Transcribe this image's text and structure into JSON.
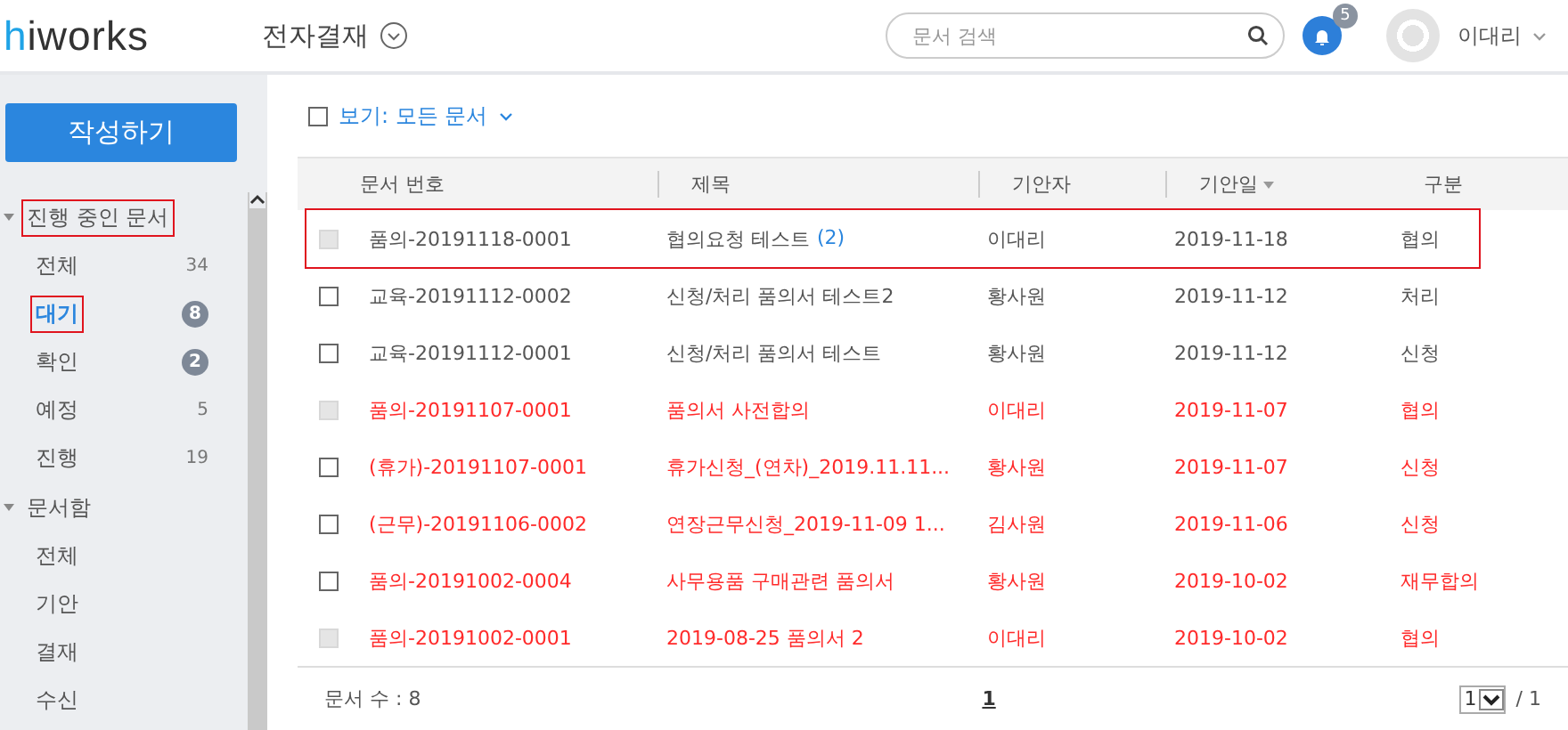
{
  "header": {
    "logo": {
      "accent": "h",
      "rest": "iworks"
    },
    "app_title": "전자결재",
    "search": {
      "placeholder": "문서 검색"
    },
    "notifications": {
      "count": "5"
    },
    "user": {
      "name": "이대리"
    }
  },
  "sidebar": {
    "compose_button": "작성하기",
    "sections": [
      {
        "label": "진행 중인 문서",
        "expanded": true,
        "highlighted": true,
        "children": [
          {
            "label": "전체",
            "count": "34",
            "kind": "plain",
            "selected": false,
            "highlighted": false
          },
          {
            "label": "대기",
            "count": "8",
            "kind": "badge",
            "selected": true,
            "highlighted": true
          },
          {
            "label": "확인",
            "count": "2",
            "kind": "badge",
            "selected": false,
            "highlighted": false
          },
          {
            "label": "예정",
            "count": "5",
            "kind": "plain",
            "selected": false,
            "highlighted": false
          },
          {
            "label": "진행",
            "count": "19",
            "kind": "plain",
            "selected": false,
            "highlighted": false
          }
        ]
      },
      {
        "label": "문서함",
        "expanded": true,
        "highlighted": false,
        "children": [
          {
            "label": "전체",
            "selected": false,
            "highlighted": false
          },
          {
            "label": "기안",
            "selected": false,
            "highlighted": false
          },
          {
            "label": "결재",
            "selected": false,
            "highlighted": false
          },
          {
            "label": "수신",
            "selected": false,
            "highlighted": false
          }
        ]
      }
    ]
  },
  "filter": {
    "label": "보기: 모든 문서",
    "checked": false
  },
  "table": {
    "columns": [
      {
        "label": "문서 번호",
        "sorted": false
      },
      {
        "label": "제목",
        "sorted": false
      },
      {
        "label": "기안자",
        "sorted": false
      },
      {
        "label": "기안일",
        "sorted": true
      },
      {
        "label": "구분",
        "sorted": false
      }
    ],
    "rows": [
      {
        "number": "품의-20191118-0001",
        "title": "협의요청 테스트",
        "comments": "(2)",
        "drafter": "이대리",
        "date": "2019-11-18",
        "type": "협의",
        "color": "#555555",
        "disabled": true,
        "highlighted": true
      },
      {
        "number": "교육-20191112-0002",
        "title": "신청/처리 품의서 테스트2",
        "drafter": "황사원",
        "date": "2019-11-12",
        "type": "처리",
        "color": "#555555",
        "disabled": false,
        "highlighted": false
      },
      {
        "number": "교육-20191112-0001",
        "title": "신청/처리 품의서 테스트",
        "drafter": "황사원",
        "date": "2019-11-12",
        "type": "신청",
        "color": "#555555",
        "disabled": false,
        "highlighted": false
      },
      {
        "number": "품의-20191107-0001",
        "title": "품의서 사전합의",
        "drafter": "이대리",
        "date": "2019-11-07",
        "type": "협의",
        "color": "#ff2a2a",
        "disabled": true,
        "highlighted": false
      },
      {
        "number": "(휴가)-20191107-0001",
        "title": "휴가신청_(연차)_2019.11.11...",
        "drafter": "황사원",
        "date": "2019-11-07",
        "type": "신청",
        "color": "#ff2a2a",
        "disabled": false,
        "highlighted": false
      },
      {
        "number": "(근무)-20191106-0002",
        "title": "연장근무신청_2019-11-09 1...",
        "drafter": "김사원",
        "date": "2019-11-06",
        "type": "신청",
        "color": "#ff2a2a",
        "disabled": false,
        "highlighted": false
      },
      {
        "number": "품의-20191002-0004",
        "title": "사무용품 구매관련 품의서",
        "drafter": "황사원",
        "date": "2019-10-02",
        "type": "재무합의",
        "color": "#ff2a2a",
        "disabled": false,
        "highlighted": false
      },
      {
        "number": "품의-20191002-0001",
        "title": "2019-08-25 품의서 2",
        "drafter": "이대리",
        "date": "2019-10-02",
        "type": "협의",
        "color": "#ff2a2a",
        "disabled": true,
        "highlighted": false
      }
    ]
  },
  "footer": {
    "count": "문서 수 : 8",
    "pages": [
      {
        "label": "1",
        "selected": true
      }
    ],
    "page_select": "1",
    "total": "/ 1"
  }
}
